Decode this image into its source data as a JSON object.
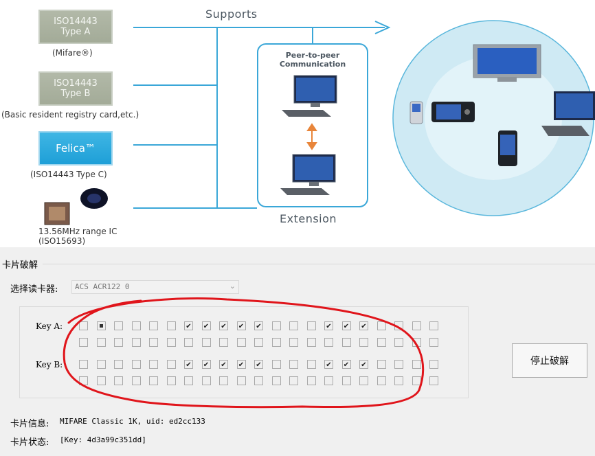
{
  "diagram": {
    "standards": [
      {
        "label": "ISO14443 Type A",
        "caption": "(Mifare®)"
      },
      {
        "label": "ISO14443 Type B",
        "caption": "(Basic resident registry card,etc.)"
      },
      {
        "label": "Felica™",
        "caption": "(ISO14443 Type C)"
      },
      {
        "label": "",
        "caption": "13.56MHz range IC (ISO15693)"
      }
    ],
    "supports_label": "Supports",
    "p2p_label": "Peer-to-peer Communication",
    "extension_label": "Extension",
    "colors": {
      "line": "#3aa7d8",
      "bubble": "#bfe3f1",
      "arrow": "#e8853a"
    }
  },
  "panel": {
    "group_title": "卡片破解",
    "reader_label": "选择读卡器:",
    "reader_value": "ACS ACR122 0",
    "key_a_label": "Key A:",
    "key_b_label": "Key B:",
    "key_a_rows": [
      [
        0,
        2,
        0,
        0,
        0,
        0,
        1,
        1,
        1,
        1,
        1,
        0,
        0,
        0,
        1,
        1,
        1,
        0,
        0,
        0,
        0
      ],
      [
        0,
        0,
        0,
        0,
        0,
        0,
        0,
        0,
        0,
        0,
        0,
        0,
        0,
        0,
        0,
        0,
        0,
        0,
        0,
        0,
        0
      ]
    ],
    "key_b_rows": [
      [
        0,
        0,
        0,
        0,
        0,
        0,
        1,
        1,
        1,
        1,
        1,
        0,
        0,
        0,
        1,
        1,
        1,
        0,
        0,
        0,
        0
      ],
      [
        0,
        0,
        0,
        0,
        0,
        0,
        0,
        0,
        0,
        0,
        0,
        0,
        0,
        0,
        0,
        0,
        0,
        0,
        0,
        0,
        0
      ]
    ],
    "stop_button": "停止破解",
    "card_info_label": "卡片信息:",
    "card_info_value": "MIFARE Classic 1K, uid: ed2cc133",
    "card_status_label": "卡片状态:",
    "card_status_value": "[Key: 4d3a99c351dd]",
    "annotation_color": "#e0151b"
  }
}
